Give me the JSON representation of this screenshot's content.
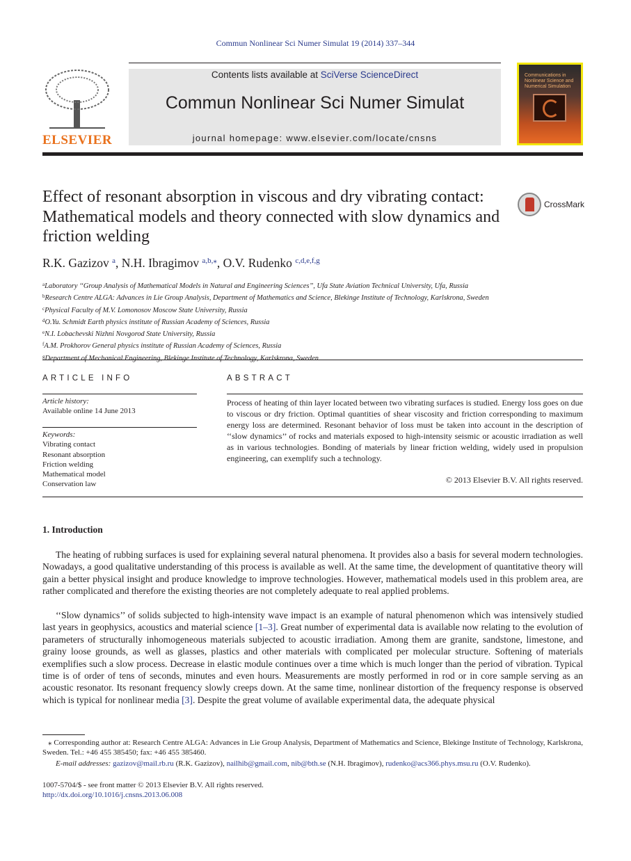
{
  "header": {
    "citation": "Commun Nonlinear Sci Numer Simulat 19 (2014) 337–344",
    "contents_prefix": "Contents lists available at ",
    "contents_link": "SciVerse ScienceDirect",
    "journal_title": "Commun Nonlinear Sci Numer Simulat",
    "homepage": "journal homepage: www.elsevier.com/locate/cnsns",
    "publisher_logo": "ELSEVIER",
    "cover_text": "Communications in Nonlinear Science and Numerical Simulation",
    "colors": {
      "link": "#2a3a8c",
      "elsevier": "#e9711c",
      "cover_border": "#f2e60c"
    }
  },
  "article": {
    "title": "Effect of resonant absorption in viscous and dry vibrating contact: Mathematical models and theory connected with slow dynamics and friction welding",
    "crossmark": "CrossMark",
    "authors": [
      {
        "name": "R.K. Gazizov",
        "sup": "a"
      },
      {
        "name": "N.H. Ibragimov",
        "sup": "a,b,⁎"
      },
      {
        "name": "O.V. Rudenko",
        "sup": "c,d,e,f,g"
      }
    ],
    "affiliations": [
      {
        "sup": "a",
        "text": "Laboratory ‘‘Group Analysis of Mathematical Models in Natural and Engineering Sciences’’, Ufa State Aviation Technical University, Ufa, Russia"
      },
      {
        "sup": "b",
        "text": "Research Centre ALGA: Advances in Lie Group Analysis, Department of Mathematics and Science, Blekinge Institute of Technology, Karlskrona, Sweden"
      },
      {
        "sup": "c",
        "text": "Physical Faculty of M.V. Lomonosov Moscow State University, Russia"
      },
      {
        "sup": "d",
        "text": "O.Yu. Schmidt Earth physics institute of Russian Academy of Sciences, Russia"
      },
      {
        "sup": "e",
        "text": "N.I. Lobachevski Nizhni Novgorod State University, Russia"
      },
      {
        "sup": "f",
        "text": "A.M. Prokhorov General physics institute of Russian Academy of Sciences, Russia"
      },
      {
        "sup": "g",
        "text": "Department of Mechanical Engineering, Blekinge Institute of Technology, Karlskrona, Sweden"
      }
    ]
  },
  "info": {
    "heading": "ARTICLE INFO",
    "history_label": "Article history:",
    "history": "Available online 14 June 2013",
    "keywords_label": "Keywords:",
    "keywords": [
      "Vibrating contact",
      "Resonant absorption",
      "Friction welding",
      "Mathematical model",
      "Conservation law"
    ]
  },
  "abstract": {
    "heading": "ABSTRACT",
    "text": "Process of heating of thin layer located between two vibrating surfaces is studied. Energy loss goes on due to viscous or dry friction. Optimal quantities of shear viscosity and friction corresponding to maximum energy loss are determined. Resonant behavior of loss must be taken into account in the description of ‘‘slow dynamics’’ of rocks and materials exposed to high-intensity seismic or acoustic irradiation as well as in various technologies. Bonding of materials by linear friction welding, widely used in propulsion engineering, can exemplify such a technology.",
    "copyright": "© 2013 Elsevier B.V. All rights reserved."
  },
  "intro": {
    "heading": "1. Introduction",
    "p1": "The heating of rubbing surfaces is used for explaining several natural phenomena. It provides also a basis for several modern technologies. Nowadays, a good qualitative understanding of this process is available as well. At the same time, the development of quantitative theory will gain a better physical insight and produce knowledge to improve technologies. However, mathematical models used in this problem area, are rather complicated and therefore the existing theories are not completely adequate to real applied problems.",
    "p2a": "‘‘Slow dynamics’’ of solids subjected to high-intensity wave impact is an example of natural phenomenon which was intensively studied last years in geophysics, acoustics and material science ",
    "ref1": "[1–3]",
    "p2b": ". Great number of experimental data is available now relating to the evolution of parameters of structurally inhomogeneous materials subjected to acoustic irradiation. Among them are granite, sandstone, limestone, and grainy loose grounds, as well as glasses, plastics and other materials with complicated per molecular structure. Softening of materials exemplifies such a slow process. Decrease in elastic module continues over a time which is much longer than the period of vibration. Typical time is of order of tens of seconds, minutes and even hours. Measurements are mostly performed in rod or in core sample serving as an acoustic resonator. Its resonant frequency slowly creeps down. At the same time, nonlinear distortion of the frequency response is observed which is typical for nonlinear media ",
    "ref2": "[3]",
    "p2c": ". Despite the great volume of available experimental data, the adequate physical"
  },
  "footnotes": {
    "corresponding": "⁎ Corresponding author at: Research Centre ALGA: Advances in Lie Group Analysis, Department of Mathematics and Science, Blekinge Institute of Technology, Karlskrona, Sweden. Tel.: +46 455 385450; fax: +46 455 385460.",
    "email_label": "E-mail addresses:",
    "email1": "gazizov@mail.rb.ru",
    "name1": " (R.K. Gazizov), ",
    "email2": "nailhib@gmail.com",
    "sep": ", ",
    "email3": "nib@bth.se",
    "name2": " (N.H. Ibragimov), ",
    "email4": "rudenko@acs366.phys.msu.ru",
    "name3": " (O.V. Rudenko).",
    "issn": "1007-5704/$ - see front matter © 2013 Elsevier B.V. All rights reserved.",
    "doi": "http://dx.doi.org/10.1016/j.cnsns.2013.06.008"
  }
}
